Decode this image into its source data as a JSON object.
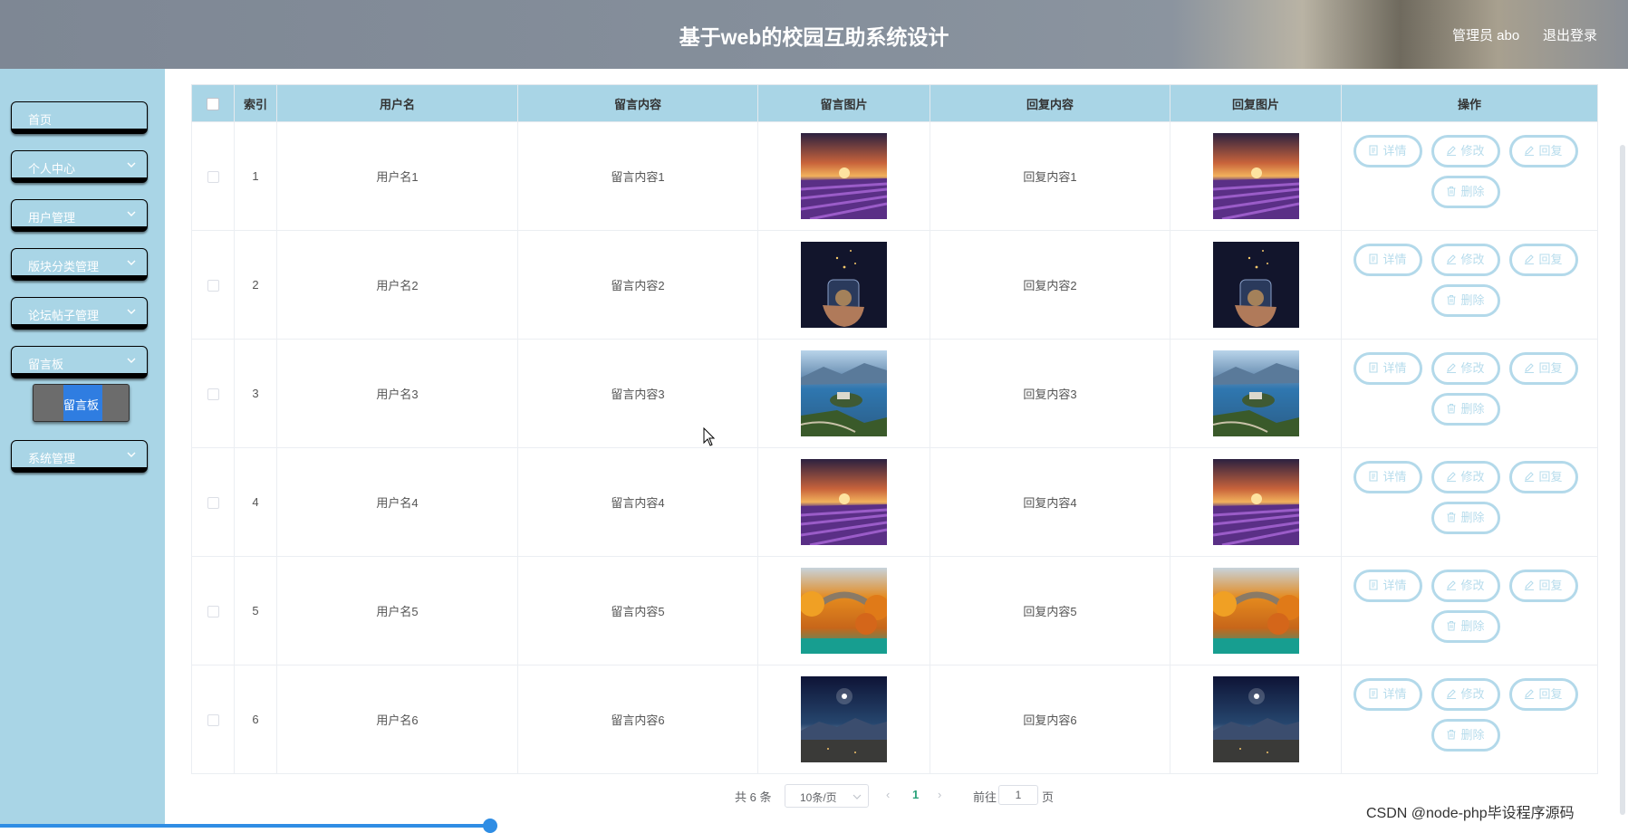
{
  "header": {
    "title": "基于web的校园互助系统设计",
    "admin_label": "管理员 abo",
    "logout_label": "退出登录"
  },
  "sidebar": {
    "items": [
      {
        "label": "首页",
        "has_children": false
      },
      {
        "label": "个人中心",
        "has_children": true
      },
      {
        "label": "用户管理",
        "has_children": true
      },
      {
        "label": "版块分类管理",
        "has_children": true
      },
      {
        "label": "论坛帖子管理",
        "has_children": true
      },
      {
        "label": "留言板",
        "has_children": true
      },
      {
        "label": "系统管理",
        "has_children": true
      }
    ],
    "active_submenu": "留言板"
  },
  "table": {
    "columns": [
      "",
      "索引",
      "用户名",
      "留言内容",
      "留言图片",
      "回复内容",
      "回复图片",
      "操作"
    ],
    "rows": [
      {
        "index": "1",
        "username": "用户名1",
        "message": "留言内容1",
        "reply": "回复内容1",
        "image": "lavender-field-sunset"
      },
      {
        "index": "2",
        "username": "用户名2",
        "message": "留言内容2",
        "reply": "回复内容2",
        "image": "glowing-jar-night"
      },
      {
        "index": "3",
        "username": "用户名3",
        "message": "留言内容3",
        "reply": "回复内容3",
        "image": "lake-island-mountains"
      },
      {
        "index": "4",
        "username": "用户名4",
        "message": "留言内容4",
        "reply": "回复内容4",
        "image": "lavender-field-sunset"
      },
      {
        "index": "5",
        "username": "用户名5",
        "message": "留言内容5",
        "reply": "回复内容5",
        "image": "autumn-stone-bridge"
      },
      {
        "index": "6",
        "username": "用户名6",
        "message": "留言内容6",
        "reply": "回复内容6",
        "image": "night-sky-valley"
      }
    ],
    "actions": {
      "detail": "详情",
      "edit": "修改",
      "reply": "回复",
      "delete": "删除"
    }
  },
  "pagination": {
    "total_label": "共 6 条",
    "page_size": "10条/页",
    "current_page": "1",
    "goto_label": "前往",
    "goto_value": "1",
    "page_suffix": "页"
  },
  "watermark": "CSDN @node-php毕设程序源码",
  "colors": {
    "sidebar_bg": "#a9d5e6",
    "table_header_bg": "#a9d5e6",
    "action_border": "#b3d9ea",
    "active_submenu": "#2f7de1",
    "current_page": "#2aa27a"
  }
}
